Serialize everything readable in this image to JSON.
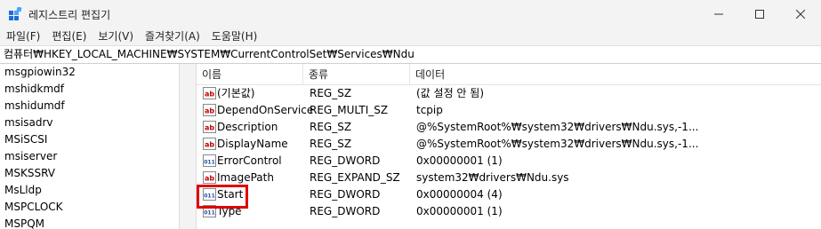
{
  "window": {
    "title": "레지스트리 편집기"
  },
  "menu": [
    "파일(F)",
    "편집(E)",
    "보기(V)",
    "즐겨찾기(A)",
    "도움말(H)"
  ],
  "address": "컴퓨터₩HKEY_LOCAL_MACHINE₩SYSTEM₩CurrentControlSet₩Services₩Ndu",
  "tree": [
    "msgpiowin32",
    "mshidkmdf",
    "mshidumdf",
    "msisadrv",
    "MSiSCSI",
    "msiserver",
    "MSKSSRV",
    "MsLldp",
    "MSPCLOCK",
    "MSPQM"
  ],
  "columns": {
    "name": "이름",
    "type": "종류",
    "data": "데이터"
  },
  "rows": [
    {
      "icon": "string-value-icon",
      "name": "(기본값)",
      "type": "REG_SZ",
      "data": "(값 설정 안 됨)"
    },
    {
      "icon": "string-value-icon",
      "name": "DependOnService",
      "type": "REG_MULTI_SZ",
      "data": "tcpip"
    },
    {
      "icon": "string-value-icon",
      "name": "Description",
      "type": "REG_SZ",
      "data": "@%SystemRoot%₩system32₩drivers₩Ndu.sys,-1..."
    },
    {
      "icon": "string-value-icon",
      "name": "DisplayName",
      "type": "REG_SZ",
      "data": "@%SystemRoot%₩system32₩drivers₩Ndu.sys,-1..."
    },
    {
      "icon": "binary-value-icon",
      "name": "ErrorControl",
      "type": "REG_DWORD",
      "data": "0x00000001 (1)"
    },
    {
      "icon": "string-value-icon",
      "name": "ImagePath",
      "type": "REG_EXPAND_SZ",
      "data": "system32₩drivers₩Ndu.sys"
    },
    {
      "icon": "binary-value-icon",
      "name": "Start",
      "type": "REG_DWORD",
      "data": "0x00000004 (4)"
    },
    {
      "icon": "binary-value-icon",
      "name": "Type",
      "type": "REG_DWORD",
      "data": "0x00000001 (1)"
    }
  ],
  "colors": {
    "highlight": "#e00000",
    "string_icon": "#c00000",
    "binary_icon": "#1f4fa0"
  }
}
